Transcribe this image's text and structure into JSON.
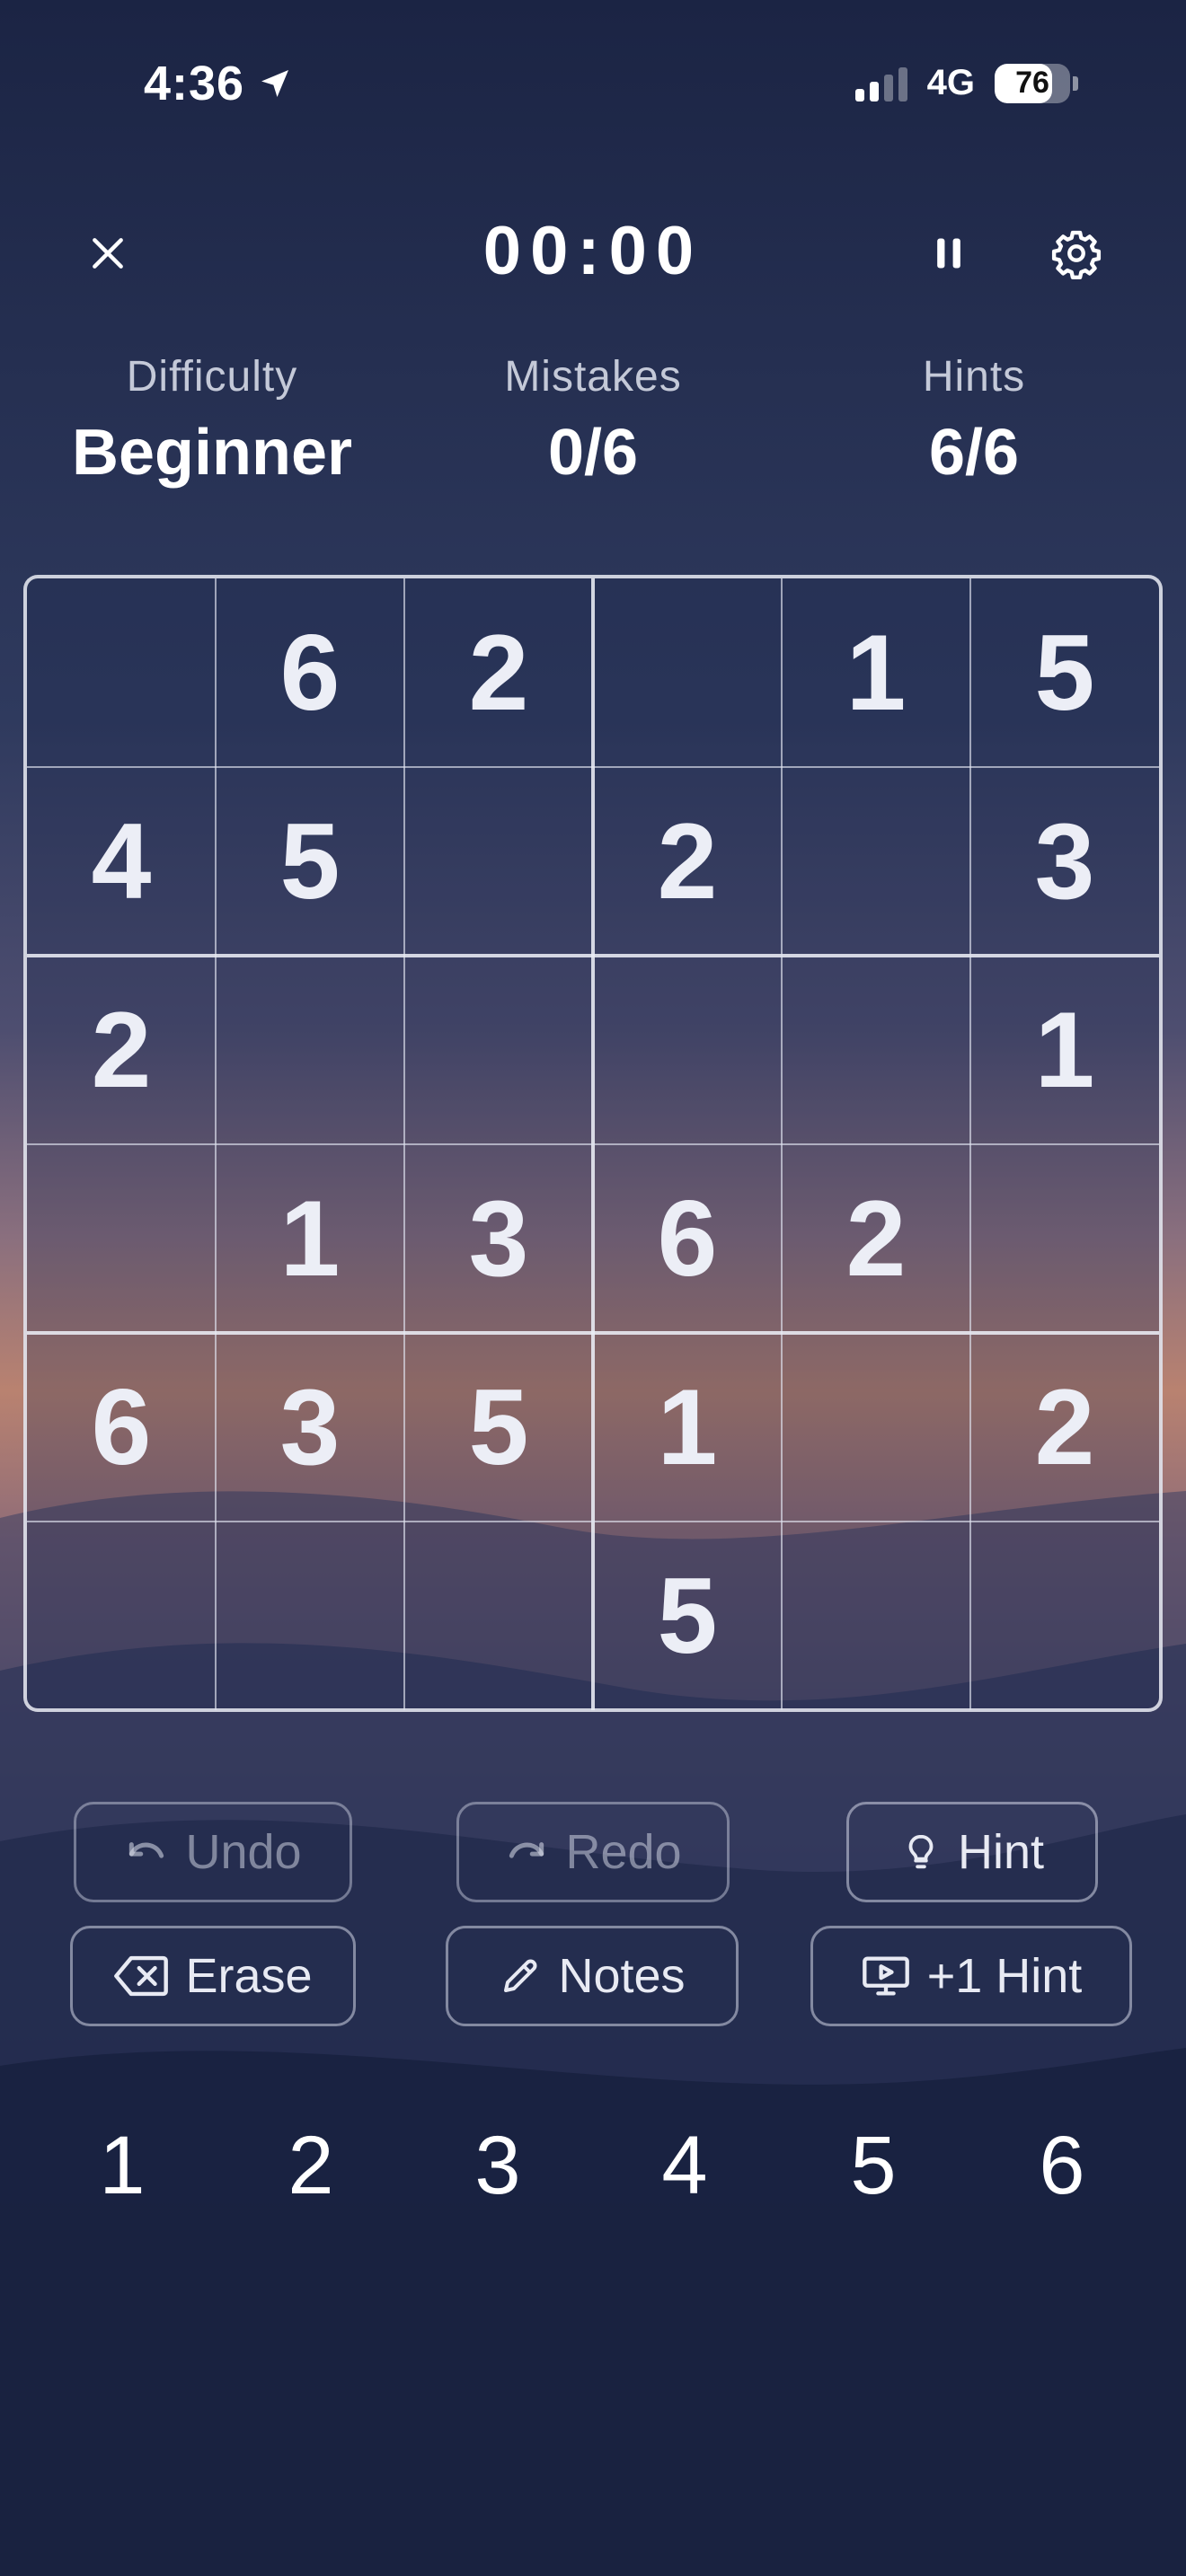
{
  "status_bar": {
    "time": "4:36",
    "network": "4G",
    "battery": "76",
    "battery_level": 0.76,
    "icons": [
      "location-arrow-icon",
      "signal-icon",
      "battery-icon"
    ]
  },
  "top_bar": {
    "timer": "00:00",
    "icons": [
      "close-icon",
      "pause-icon",
      "gear-icon"
    ]
  },
  "stats": {
    "difficulty_label": "Difficulty",
    "difficulty_value": "Beginner",
    "mistakes_label": "Mistakes",
    "mistakes_value": "0/6",
    "hints_label": "Hints",
    "hints_value": "6/6"
  },
  "board": {
    "cells": [
      [
        "",
        "6",
        "2",
        "",
        "1",
        "5"
      ],
      [
        "4",
        "5",
        "",
        "2",
        "",
        "3"
      ],
      [
        "2",
        "",
        "",
        "",
        "",
        "1"
      ],
      [
        "",
        "1",
        "3",
        "6",
        "2",
        ""
      ],
      [
        "6",
        "3",
        "5",
        "1",
        "",
        "2"
      ],
      [
        "",
        "",
        "",
        "5",
        "",
        ""
      ]
    ]
  },
  "actions": {
    "undo": "Undo",
    "redo": "Redo",
    "hint": "Hint",
    "erase": "Erase",
    "notes": "Notes",
    "extra_hint": "+1 Hint",
    "icons": [
      "undo-icon",
      "redo-icon",
      "lightbulb-icon",
      "erase-icon",
      "pencil-icon",
      "video-icon"
    ]
  },
  "number_pad": [
    "1",
    "2",
    "3",
    "4",
    "5",
    "6"
  ],
  "colors": {
    "sky_top": "#1b2444",
    "sky_mid": "#7a6680",
    "sunset": "#c98a6a",
    "bottom": "#141d3a",
    "text": "#ffffff"
  }
}
